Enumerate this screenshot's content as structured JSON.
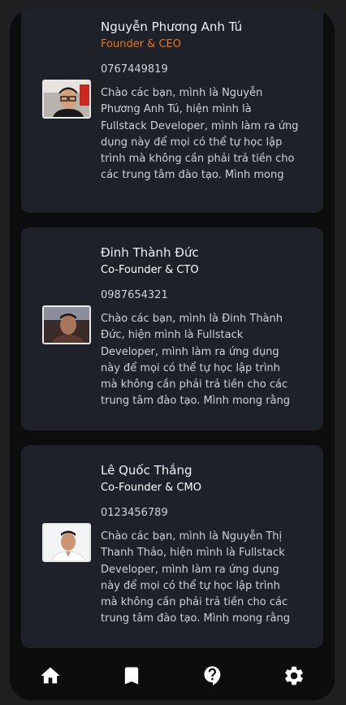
{
  "members": [
    {
      "name": "Nguyễn Phương Anh Tú",
      "role": "Founder & CEO",
      "role_color": "#e8741e",
      "phone": "0767449819",
      "bio": "Chào các bạn, mình là Nguyễn Phương Anh Tú, hiện mình là Fullstack Developer, mình làm ra ứng dụng này để mọi có thể tự học lập trình mà không cần phải trả tiền cho các trung tâm đào tạo. Mình mong"
    },
    {
      "name": "Đinh Thành Đức",
      "role": "Co-Founder & CTO",
      "role_color": "#ffffff",
      "phone": "0987654321",
      "bio": "Chào các bạn, mình là Đinh Thành Đức, hiện mình là Fullstack Developer, mình làm ra ứng dụng này để mọi có thể tự học lập trình mà không cần phải trả tiền cho các trung tâm đào tạo. Mình mong rằng"
    },
    {
      "name": "Lê Quốc Thắng",
      "role": "Co-Founder & CMO",
      "role_color": "#ffffff",
      "phone": "0123456789",
      "bio": "Chào các bạn, mình là Nguyễn Thị Thanh Thảo, hiện mình là Fullstack Developer, mình làm ra ứng dụng này để mọi có thể tự học lập trình mà không cần phải trả tiền cho các trung tâm đào tạo. Mình mong rằng"
    }
  ],
  "nav": [
    {
      "icon": "home-icon"
    },
    {
      "icon": "bookmark-icon"
    },
    {
      "icon": "help-icon"
    },
    {
      "icon": "settings-icon"
    }
  ],
  "colors": {
    "background": "#0d0d0e",
    "card": "#1e2228",
    "accent": "#e8741e"
  }
}
